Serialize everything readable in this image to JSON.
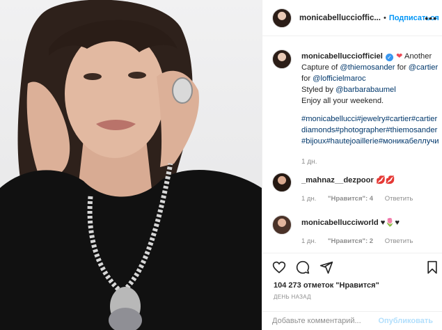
{
  "post": {
    "author": "monicabellucciofficiel",
    "header_author": "monicabelluccioffic...",
    "follow_label": "Подписаться",
    "dot": "•",
    "more_label": "•••",
    "caption": {
      "text_1": "Another Capture of",
      "mention_1": "@thiemosander",
      "text_2": "for",
      "mention_2": "@cartier",
      "text_3": "for",
      "mention_3": "@lofficielmaroc",
      "text_4": "Styled by",
      "mention_4": "@barbarabaumel",
      "text_5": "Enjoy all your weekend.",
      "hashtags": "#monicabellucci#jewelry#cartier#cartierdiamonds#photographer#thiemosander#bijoux#hautejoaillerie#моникабеллучи",
      "time": "1 дн."
    },
    "comments": [
      {
        "user": "_mahnaz__dezpoor",
        "text": "💋💋",
        "time": "1 дн.",
        "likes": "\"Нравится\": 4",
        "reply": "Ответить"
      },
      {
        "user": "monicabellucciworld",
        "text": "♥🌷♥",
        "time": "1 дн.",
        "likes": "\"Нравится\": 2",
        "reply": "Ответить"
      }
    ],
    "likes_count": "104 273 отметок \"Нравится\"",
    "posted": "ДЕНЬ НАЗАД",
    "add_comment_placeholder": "Добавьте комментарий...",
    "publish_label": "Опубликовать"
  },
  "colors": {
    "link": "#00376b",
    "follow": "#0095f6",
    "heart": "#ed4956",
    "muted": "#8e8e8e"
  },
  "icons": [
    "heart-icon",
    "comment-icon",
    "share-icon",
    "bookmark-icon",
    "verified-icon",
    "more-icon"
  ]
}
